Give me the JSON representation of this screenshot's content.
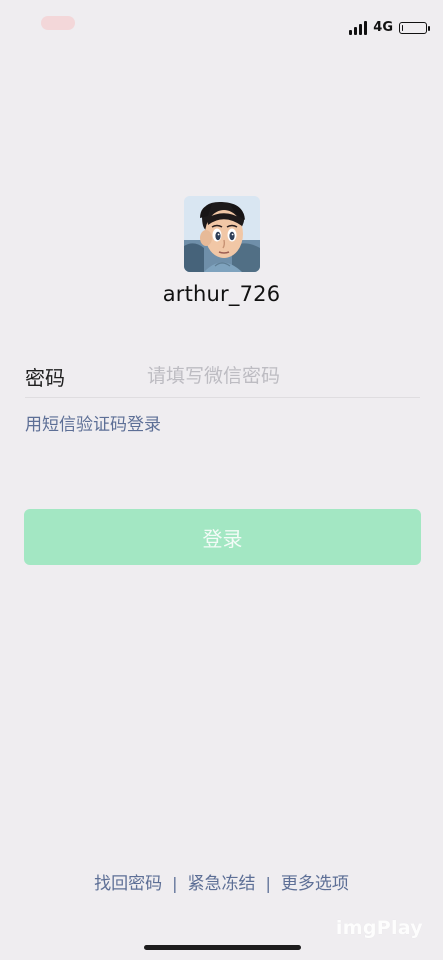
{
  "status_bar": {
    "network": "4G",
    "battery_level": 0.06
  },
  "profile": {
    "username": "arthur_726"
  },
  "form": {
    "password_label": "密码",
    "password_placeholder": "请填写微信密码",
    "password_value": ""
  },
  "sms_login": {
    "label": "用短信验证码登录"
  },
  "login_button": {
    "label": "登录",
    "color": "#a3e7c3"
  },
  "footer": {
    "links": [
      {
        "label": "找回密码"
      },
      {
        "label": "紧急冻结"
      },
      {
        "label": "更多选项"
      }
    ],
    "separator": "|"
  },
  "watermark": {
    "text": "imgPlay"
  },
  "colors": {
    "background": "#efedf0",
    "link": "#5d6f96",
    "placeholder": "#bdbcc2"
  }
}
